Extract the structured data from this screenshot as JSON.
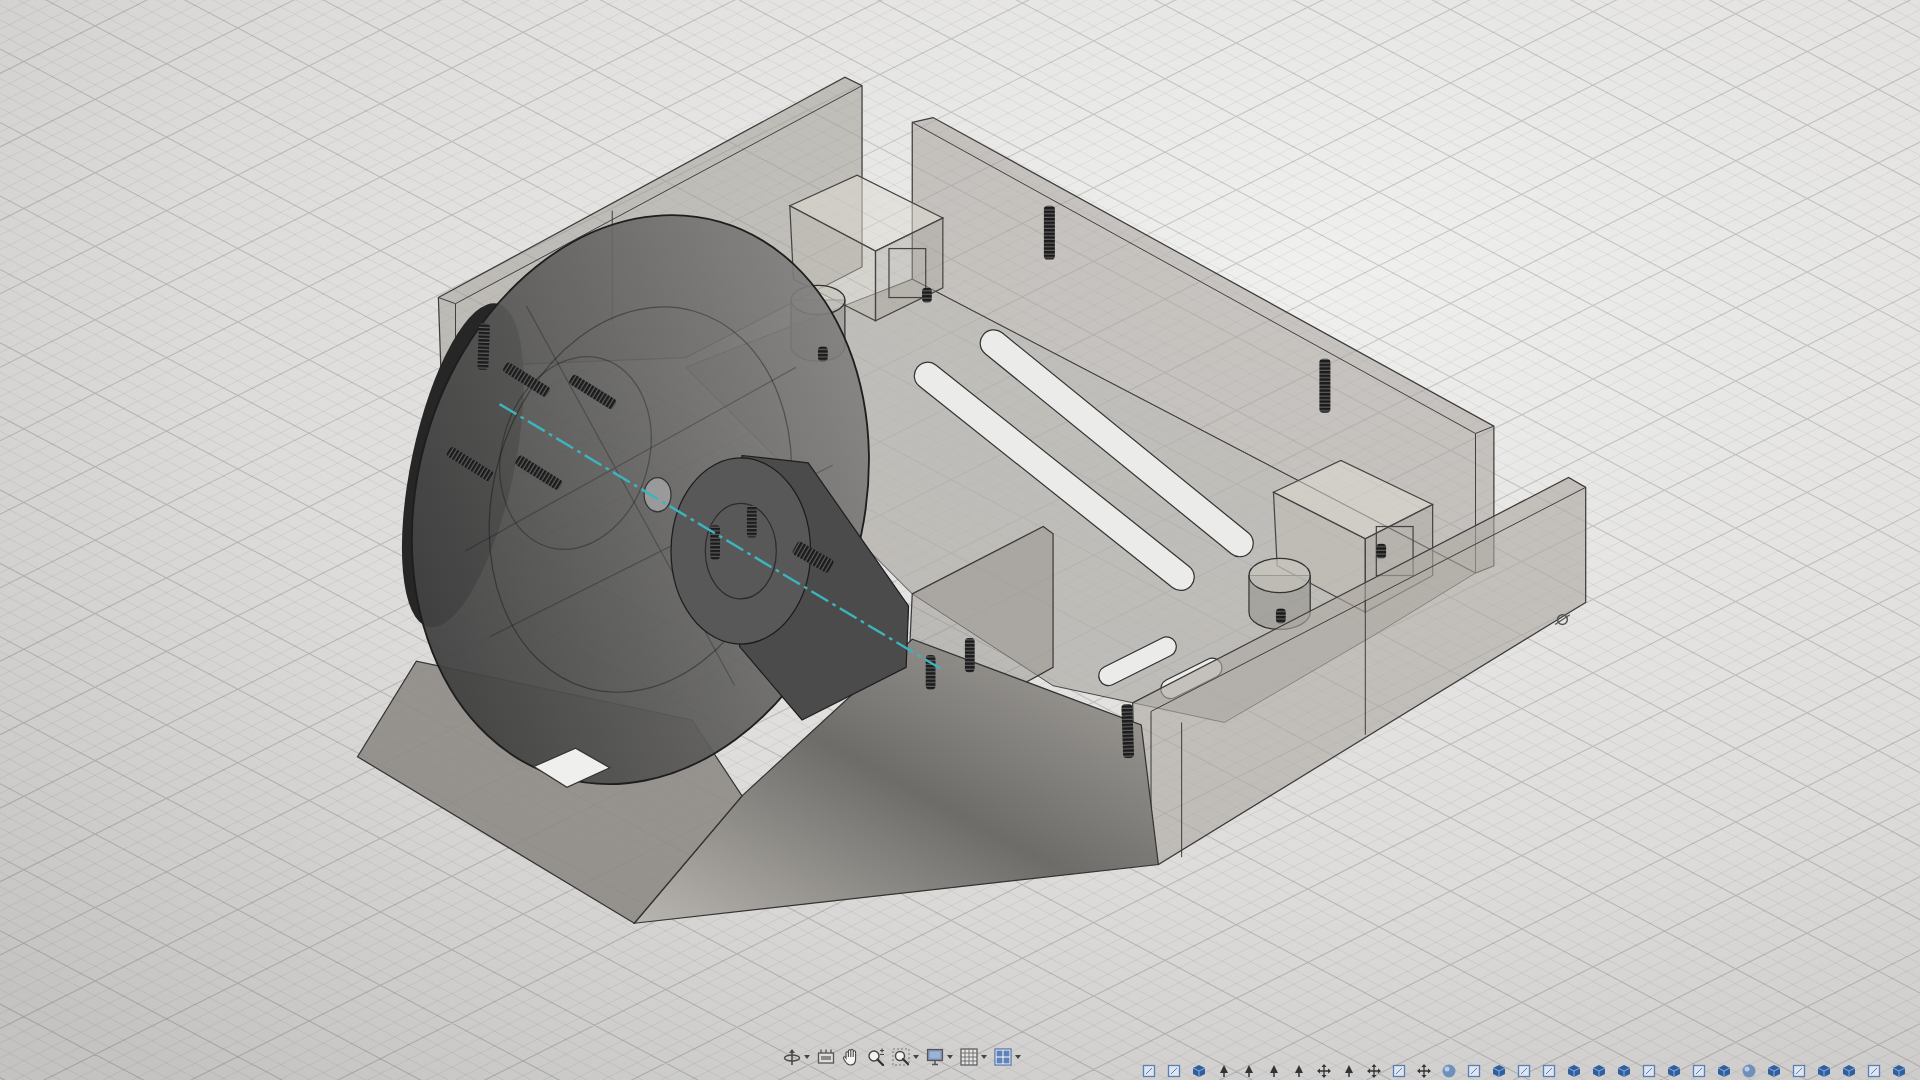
{
  "viewport": {
    "toolbar": [
      {
        "kind": "orbit",
        "dropdown": true
      },
      {
        "kind": "look_at",
        "dropdown": false
      },
      {
        "kind": "pan",
        "dropdown": false
      },
      {
        "kind": "zoom",
        "dropdown": false
      },
      {
        "kind": "fit",
        "dropdown": true
      },
      {
        "kind": "display",
        "dropdown": true
      },
      {
        "kind": "grid",
        "dropdown": true
      },
      {
        "kind": "viewports",
        "dropdown": true
      }
    ]
  },
  "timeline": {
    "features": [
      {
        "kind": "outline"
      },
      {
        "kind": "outline"
      },
      {
        "kind": "cube"
      },
      {
        "kind": "pin"
      },
      {
        "kind": "pin"
      },
      {
        "kind": "pin"
      },
      {
        "kind": "pin"
      },
      {
        "kind": "cross"
      },
      {
        "kind": "pin"
      },
      {
        "kind": "cross"
      },
      {
        "kind": "outline"
      },
      {
        "kind": "cross"
      },
      {
        "kind": "sphere"
      },
      {
        "kind": "outline"
      },
      {
        "kind": "cube"
      },
      {
        "kind": "outline"
      },
      {
        "kind": "outline"
      },
      {
        "kind": "cube"
      },
      {
        "kind": "cube"
      },
      {
        "kind": "cube"
      },
      {
        "kind": "outline"
      },
      {
        "kind": "cube"
      },
      {
        "kind": "outline"
      },
      {
        "kind": "cube"
      },
      {
        "kind": "sphere"
      },
      {
        "kind": "cube"
      },
      {
        "kind": "outline"
      },
      {
        "kind": "cube"
      },
      {
        "kind": "cube"
      },
      {
        "kind": "outline"
      },
      {
        "kind": "cube"
      }
    ]
  }
}
